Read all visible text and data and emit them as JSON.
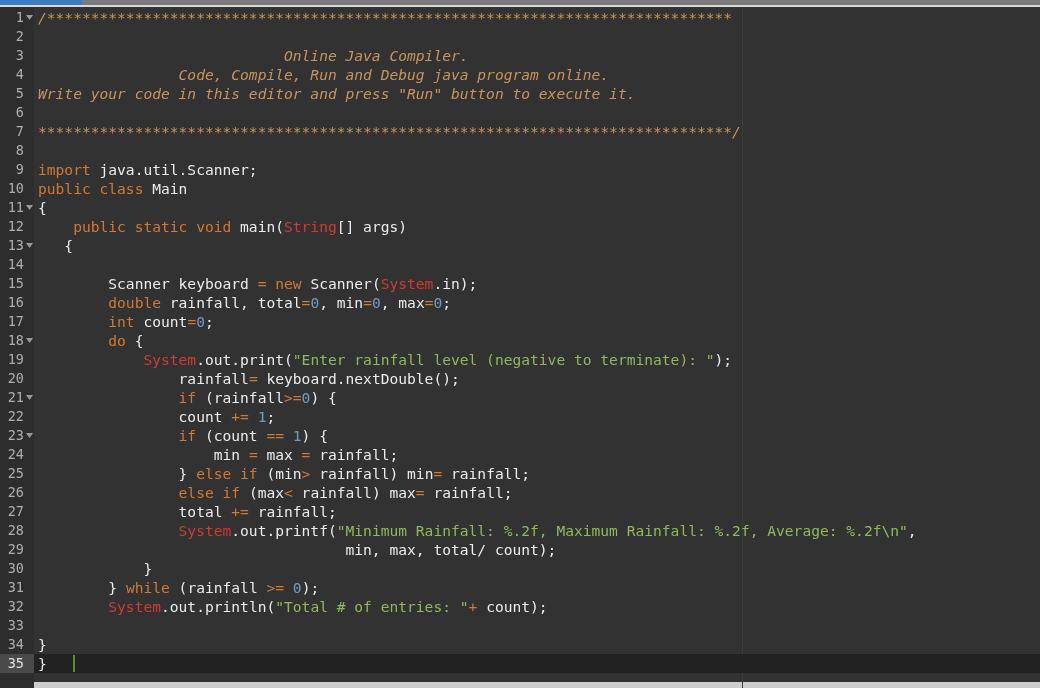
{
  "editor": {
    "lines": [
      {
        "number": "1",
        "foldable": true,
        "active": false,
        "tokens": [
          {
            "kind": "comment",
            "text": "/******************************************************************************"
          }
        ]
      },
      {
        "number": "2",
        "foldable": false,
        "active": false
      },
      {
        "number": "3",
        "foldable": false,
        "active": false,
        "tokens": [
          {
            "kind": "comment",
            "text": "                            Online Java Compiler."
          }
        ]
      },
      {
        "number": "4",
        "foldable": false,
        "active": false,
        "tokens": [
          {
            "kind": "comment",
            "text": "                Code, Compile, Run and Debug java program online."
          }
        ]
      },
      {
        "number": "5",
        "foldable": false,
        "active": false,
        "tokens": [
          {
            "kind": "comment",
            "text": "Write your code in this editor and press \"Run\" button to execute it."
          }
        ]
      },
      {
        "number": "6",
        "foldable": false,
        "active": false
      },
      {
        "number": "7",
        "foldable": false,
        "active": false,
        "tokens": [
          {
            "kind": "comment",
            "text": "*******************************************************************************/"
          }
        ]
      },
      {
        "number": "8",
        "foldable": false,
        "active": false
      },
      {
        "number": "9",
        "foldable": false,
        "active": false,
        "tokens": [
          {
            "kind": "kw",
            "text": "import"
          },
          {
            "kind": "plain",
            "text": " java.util.Scanner;"
          }
        ]
      },
      {
        "number": "10",
        "foldable": false,
        "active": false,
        "tokens": [
          {
            "kind": "kw",
            "text": "public class"
          },
          {
            "kind": "plain",
            "text": " Main"
          }
        ]
      },
      {
        "number": "11",
        "foldable": true,
        "active": false,
        "tokens": [
          {
            "kind": "plain",
            "text": "{"
          }
        ]
      },
      {
        "number": "12",
        "foldable": false,
        "active": false,
        "tokens": [
          {
            "kind": "kw",
            "text": "    public static void"
          },
          {
            "kind": "plain",
            "text": " main("
          },
          {
            "kind": "cls",
            "text": "String"
          },
          {
            "kind": "plain",
            "text": "[] args)"
          }
        ]
      },
      {
        "number": "13",
        "foldable": true,
        "active": false,
        "tokens": [
          {
            "kind": "plain",
            "text": "   {"
          }
        ]
      },
      {
        "number": "14",
        "foldable": false,
        "active": false
      },
      {
        "number": "15",
        "foldable": false,
        "active": false,
        "tokens": [
          {
            "kind": "plain",
            "text": "        Scanner keyboard "
          },
          {
            "kind": "op",
            "text": "= "
          },
          {
            "kind": "kw",
            "text": "new"
          },
          {
            "kind": "plain",
            "text": " Scanner("
          },
          {
            "kind": "cls",
            "text": "System"
          },
          {
            "kind": "plain",
            "text": ".in);"
          }
        ]
      },
      {
        "number": "16",
        "foldable": false,
        "active": false,
        "tokens": [
          {
            "kind": "kw",
            "text": "        double"
          },
          {
            "kind": "plain",
            "text": " rainfall, total"
          },
          {
            "kind": "op",
            "text": "="
          },
          {
            "kind": "num",
            "text": "0"
          },
          {
            "kind": "plain",
            "text": ", min"
          },
          {
            "kind": "op",
            "text": "="
          },
          {
            "kind": "num",
            "text": "0"
          },
          {
            "kind": "plain",
            "text": ", max"
          },
          {
            "kind": "op",
            "text": "="
          },
          {
            "kind": "num",
            "text": "0"
          },
          {
            "kind": "plain",
            "text": ";"
          }
        ]
      },
      {
        "number": "17",
        "foldable": false,
        "active": false,
        "tokens": [
          {
            "kind": "kw",
            "text": "        int"
          },
          {
            "kind": "plain",
            "text": " count"
          },
          {
            "kind": "op",
            "text": "="
          },
          {
            "kind": "num",
            "text": "0"
          },
          {
            "kind": "plain",
            "text": ";"
          }
        ]
      },
      {
        "number": "18",
        "foldable": true,
        "active": false,
        "tokens": [
          {
            "kind": "kw",
            "text": "        do"
          },
          {
            "kind": "plain",
            "text": " {"
          }
        ]
      },
      {
        "number": "19",
        "foldable": false,
        "active": false,
        "tokens": [
          {
            "kind": "cls",
            "text": "            System"
          },
          {
            "kind": "plain",
            "text": ".out.print("
          },
          {
            "kind": "str",
            "text": "\"Enter rainfall level (negative to terminate): \""
          },
          {
            "kind": "plain",
            "text": ");"
          }
        ]
      },
      {
        "number": "20",
        "foldable": false,
        "active": false,
        "tokens": [
          {
            "kind": "plain",
            "text": "                rainfall"
          },
          {
            "kind": "op",
            "text": "="
          },
          {
            "kind": "plain",
            "text": " keyboard.nextDouble();"
          }
        ]
      },
      {
        "number": "21",
        "foldable": true,
        "active": false,
        "tokens": [
          {
            "kind": "kw",
            "text": "                if"
          },
          {
            "kind": "plain",
            "text": " (rainfall"
          },
          {
            "kind": "op",
            "text": ">="
          },
          {
            "kind": "num",
            "text": "0"
          },
          {
            "kind": "plain",
            "text": ") {"
          }
        ]
      },
      {
        "number": "22",
        "foldable": false,
        "active": false,
        "tokens": [
          {
            "kind": "plain",
            "text": "                count "
          },
          {
            "kind": "op",
            "text": "+= "
          },
          {
            "kind": "num",
            "text": "1"
          },
          {
            "kind": "plain",
            "text": ";"
          }
        ]
      },
      {
        "number": "23",
        "foldable": true,
        "active": false,
        "tokens": [
          {
            "kind": "kw",
            "text": "                if"
          },
          {
            "kind": "plain",
            "text": " (count "
          },
          {
            "kind": "op",
            "text": "== "
          },
          {
            "kind": "num",
            "text": "1"
          },
          {
            "kind": "plain",
            "text": ") {"
          }
        ]
      },
      {
        "number": "24",
        "foldable": false,
        "active": false,
        "tokens": [
          {
            "kind": "plain",
            "text": "                    min "
          },
          {
            "kind": "op",
            "text": "="
          },
          {
            "kind": "plain",
            "text": " max "
          },
          {
            "kind": "op",
            "text": "="
          },
          {
            "kind": "plain",
            "text": " rainfall;"
          }
        ]
      },
      {
        "number": "25",
        "foldable": false,
        "active": false,
        "tokens": [
          {
            "kind": "plain",
            "text": "                } "
          },
          {
            "kind": "kw",
            "text": "else if"
          },
          {
            "kind": "plain",
            "text": " (min"
          },
          {
            "kind": "op",
            "text": ">"
          },
          {
            "kind": "plain",
            "text": " rainfall) min"
          },
          {
            "kind": "op",
            "text": "="
          },
          {
            "kind": "plain",
            "text": " rainfall;"
          }
        ]
      },
      {
        "number": "26",
        "foldable": false,
        "active": false,
        "tokens": [
          {
            "kind": "kw",
            "text": "                else if"
          },
          {
            "kind": "plain",
            "text": " (max"
          },
          {
            "kind": "op",
            "text": "<"
          },
          {
            "kind": "plain",
            "text": " rainfall) max"
          },
          {
            "kind": "op",
            "text": "="
          },
          {
            "kind": "plain",
            "text": " rainfall;"
          }
        ]
      },
      {
        "number": "27",
        "foldable": false,
        "active": false,
        "tokens": [
          {
            "kind": "plain",
            "text": "                total "
          },
          {
            "kind": "op",
            "text": "+="
          },
          {
            "kind": "plain",
            "text": " rainfall;"
          }
        ]
      },
      {
        "number": "28",
        "foldable": false,
        "active": false,
        "tokens": [
          {
            "kind": "cls",
            "text": "                System"
          },
          {
            "kind": "plain",
            "text": ".out.printf("
          },
          {
            "kind": "str",
            "text": "\"Minimum Rainfall: %.2f, Maximum Rainfall: %.2f, Average: %.2f\\n\""
          },
          {
            "kind": "plain",
            "text": ","
          }
        ]
      },
      {
        "number": "29",
        "foldable": false,
        "active": false,
        "tokens": [
          {
            "kind": "plain",
            "text": "                                   min, max, total/ count);"
          }
        ]
      },
      {
        "number": "30",
        "foldable": false,
        "active": false,
        "tokens": [
          {
            "kind": "plain",
            "text": "            }"
          }
        ]
      },
      {
        "number": "31",
        "foldable": false,
        "active": false,
        "tokens": [
          {
            "kind": "plain",
            "text": "        } "
          },
          {
            "kind": "kw",
            "text": "while"
          },
          {
            "kind": "plain",
            "text": " (rainfall "
          },
          {
            "kind": "op",
            "text": ">= "
          },
          {
            "kind": "num",
            "text": "0"
          },
          {
            "kind": "plain",
            "text": ");"
          }
        ]
      },
      {
        "number": "32",
        "foldable": false,
        "active": false,
        "tokens": [
          {
            "kind": "cls",
            "text": "        System"
          },
          {
            "kind": "plain",
            "text": ".out.println("
          },
          {
            "kind": "str",
            "text": "\"Total # of entries: \""
          },
          {
            "kind": "op",
            "text": "+"
          },
          {
            "kind": "plain",
            "text": " count);"
          }
        ]
      },
      {
        "number": "33",
        "foldable": false,
        "active": false
      },
      {
        "number": "34",
        "foldable": false,
        "active": false,
        "tokens": [
          {
            "kind": "plain",
            "text": "}"
          }
        ]
      },
      {
        "number": "35",
        "foldable": false,
        "active": true,
        "tokens": [
          {
            "kind": "plain",
            "text": "}"
          }
        ]
      }
    ]
  }
}
